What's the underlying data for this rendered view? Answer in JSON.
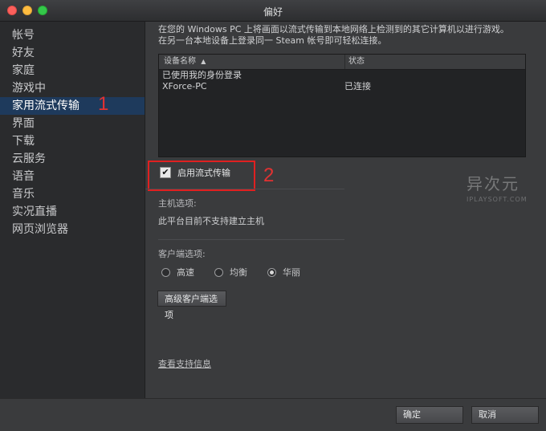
{
  "window": {
    "title": "偏好"
  },
  "sidebar": {
    "items": [
      {
        "label": "帐号"
      },
      {
        "label": "好友"
      },
      {
        "label": "家庭"
      },
      {
        "label": "游戏中"
      },
      {
        "label": "家用流式传输"
      },
      {
        "label": "界面"
      },
      {
        "label": "下载"
      },
      {
        "label": "云服务"
      },
      {
        "label": "语音"
      },
      {
        "label": "音乐"
      },
      {
        "label": "实况直播"
      },
      {
        "label": "网页浏览器"
      }
    ],
    "active_index": 4
  },
  "annotations": {
    "marker1": "1",
    "marker2": "2"
  },
  "content": {
    "intro_line1": "在您的 Windows PC 上将画面以流式传输到本地网络上检测到的其它计算机以进行游戏。",
    "intro_line2": "在另一台本地设备上登录同一 Steam 帐号即可轻松连接。",
    "table": {
      "col_device": "设备名称",
      "sort_indicator": "▲",
      "col_status": "状态",
      "rows": [
        {
          "device": "已使用我的身份登录",
          "status": ""
        },
        {
          "device": "XForce-PC",
          "status": "已连接"
        }
      ]
    },
    "enable_streaming": {
      "label": "启用流式传输",
      "checked": true,
      "check_glyph": "✔"
    },
    "host_options_label": "主机选项:",
    "host_unsupported": "此平台目前不支持建立主机",
    "client_options_label": "客户端选项:",
    "client_radios": [
      {
        "label": "高速",
        "selected": false
      },
      {
        "label": "均衡",
        "selected": false
      },
      {
        "label": "华丽",
        "selected": true
      }
    ],
    "advanced_button": "高级客户端选项",
    "support_link": "查看支持信息"
  },
  "watermark": {
    "cn": "异次元",
    "en": "IPLAYSOFT.COM"
  },
  "footer": {
    "ok": "确定",
    "cancel": "取消"
  },
  "colors": {
    "accent_red": "#e02020",
    "active_item": "#1e3a5c"
  }
}
